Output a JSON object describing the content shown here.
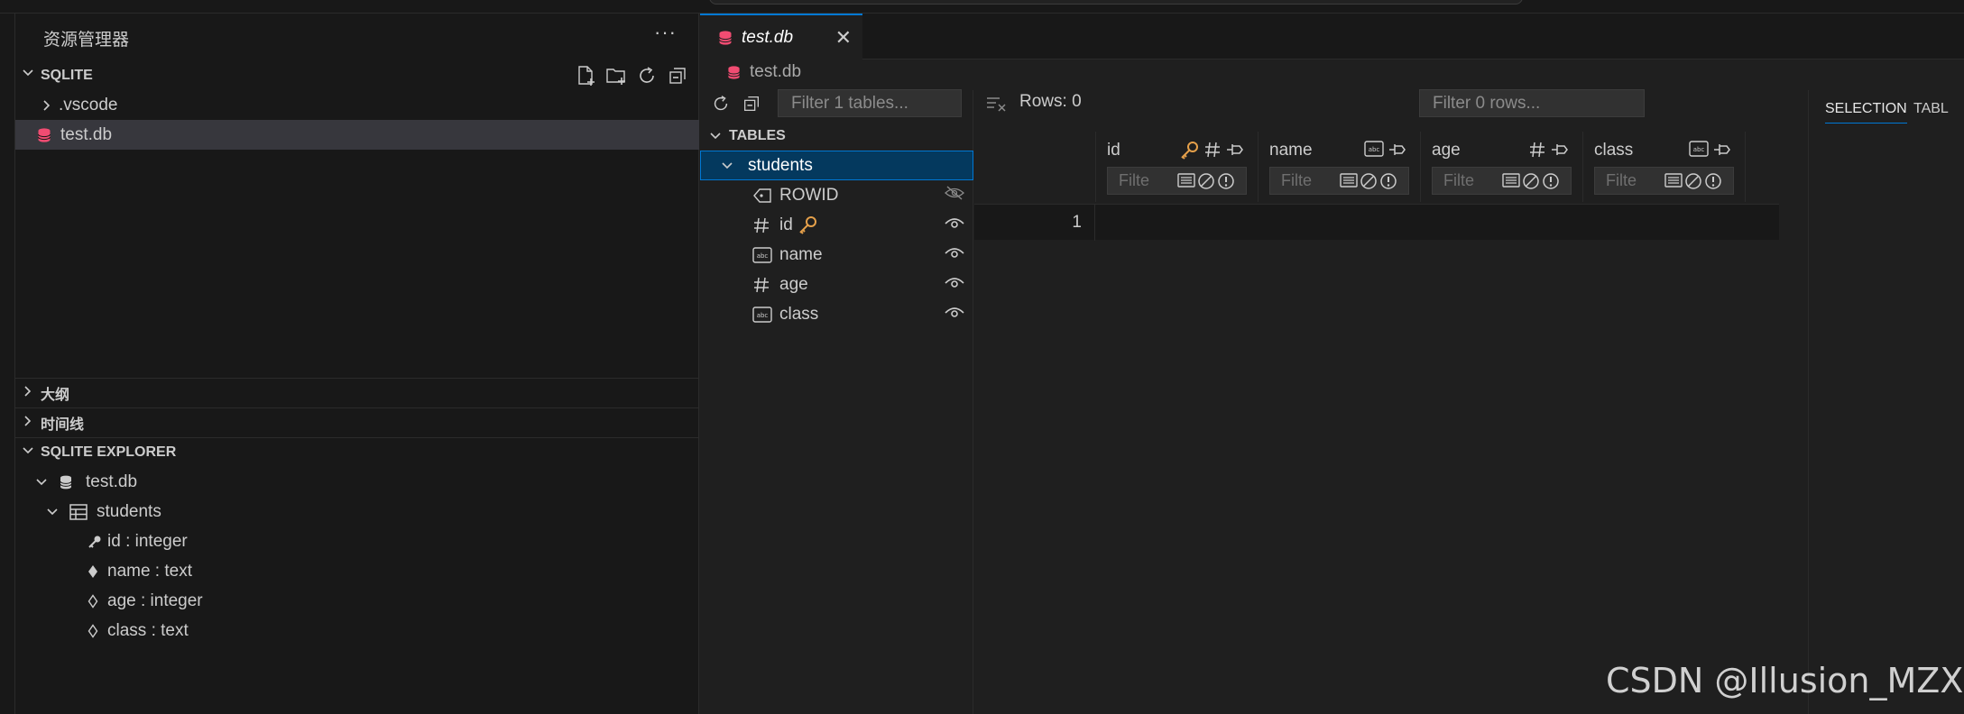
{
  "explorer": {
    "title": "资源管理器",
    "more": "···",
    "workspace_label": "SQLITE",
    "items": [
      {
        "label": ".vscode"
      },
      {
        "label": "test.db"
      }
    ]
  },
  "outline": {
    "label": "大纲"
  },
  "timeline": {
    "label": "时间线"
  },
  "sqlite_explorer": {
    "label": "SQLITE EXPLORER",
    "db": "test.db",
    "table": "students",
    "columns": [
      {
        "label": "id : integer"
      },
      {
        "label": "name : text"
      },
      {
        "label": "age : integer"
      },
      {
        "label": "class : text"
      }
    ]
  },
  "editor": {
    "tab_label": "test.db",
    "breadcrumb": "test.db",
    "tables_filter_placeholder": "Filter 1 tables...",
    "tables_header": "TABLES",
    "table_name": "students",
    "table_columns": [
      "ROWID",
      "id",
      "name",
      "age",
      "class"
    ],
    "rows_label": "Rows: 0",
    "rows_filter_placeholder": "Filter 0 rows...",
    "grid_columns": [
      "id",
      "name",
      "age",
      "class"
    ],
    "column_filter_placeholder": "Filte",
    "row_number": "1",
    "right_tabs": [
      "SELECTION",
      "TABL"
    ]
  },
  "colors": {
    "accent": "#0078d4",
    "db_icon": "#f14c72",
    "key_icon": "#e5a04a"
  },
  "watermark": "CSDN @Illusion_MZX"
}
